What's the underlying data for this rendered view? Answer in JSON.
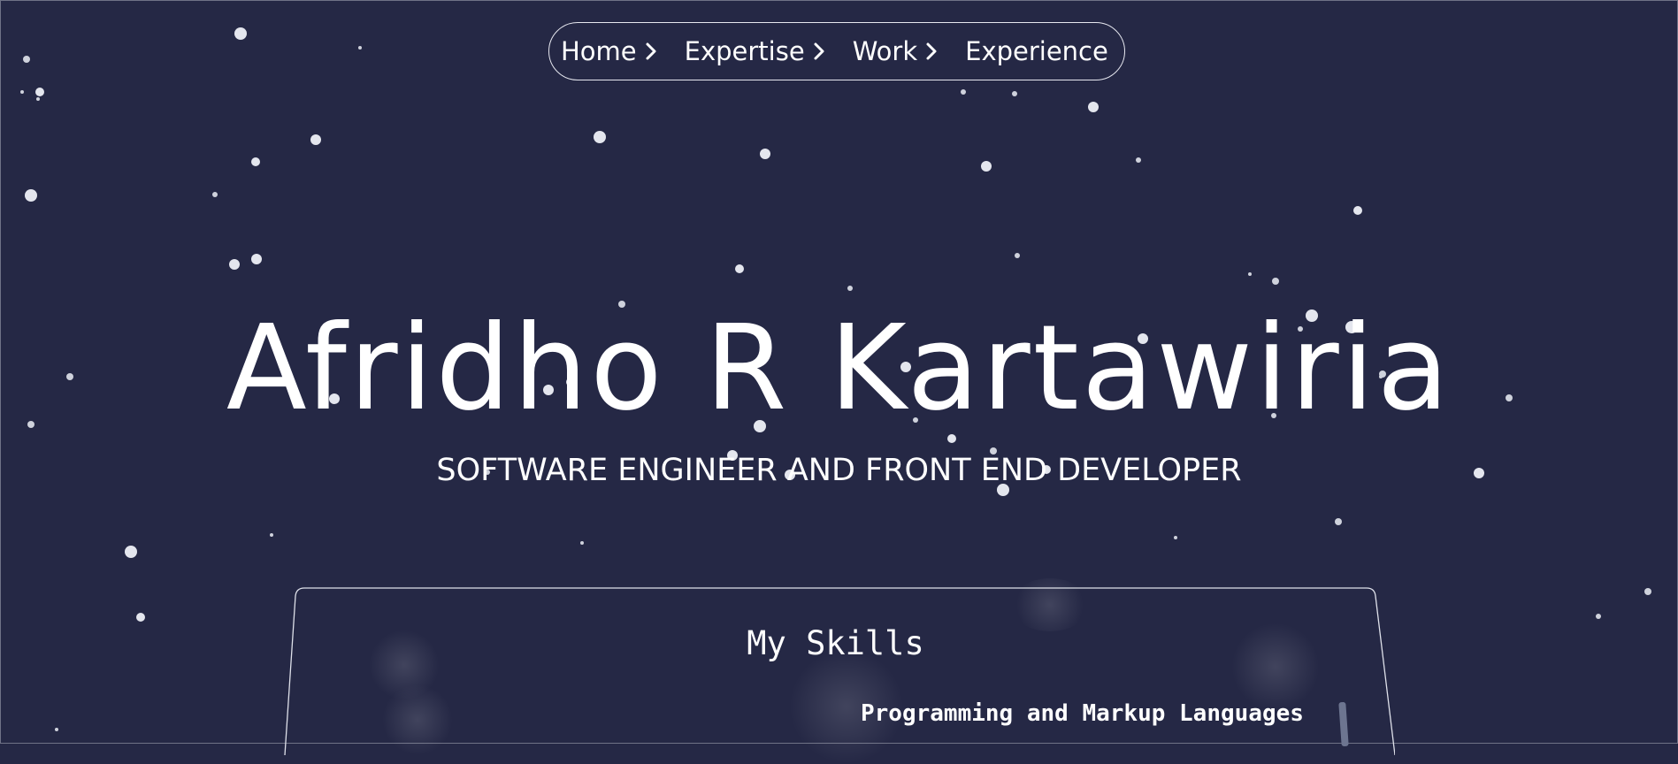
{
  "nav": {
    "items": [
      {
        "label": "Home",
        "chevron": true
      },
      {
        "label": "Expertise",
        "chevron": true
      },
      {
        "label": "Work",
        "chevron": true
      },
      {
        "label": "Experience",
        "chevron": false
      }
    ]
  },
  "hero": {
    "name": "Afridho R Kartawiria",
    "role": "SOFTWARE ENGINEER AND FRONT END DEVELOPER"
  },
  "skills": {
    "title": "My Skills",
    "category": "Programming and Markup Languages"
  },
  "colors": {
    "background": "#252845",
    "text": "#ffffff",
    "star": "#e4e6ee",
    "border": "#e7e8f0"
  }
}
